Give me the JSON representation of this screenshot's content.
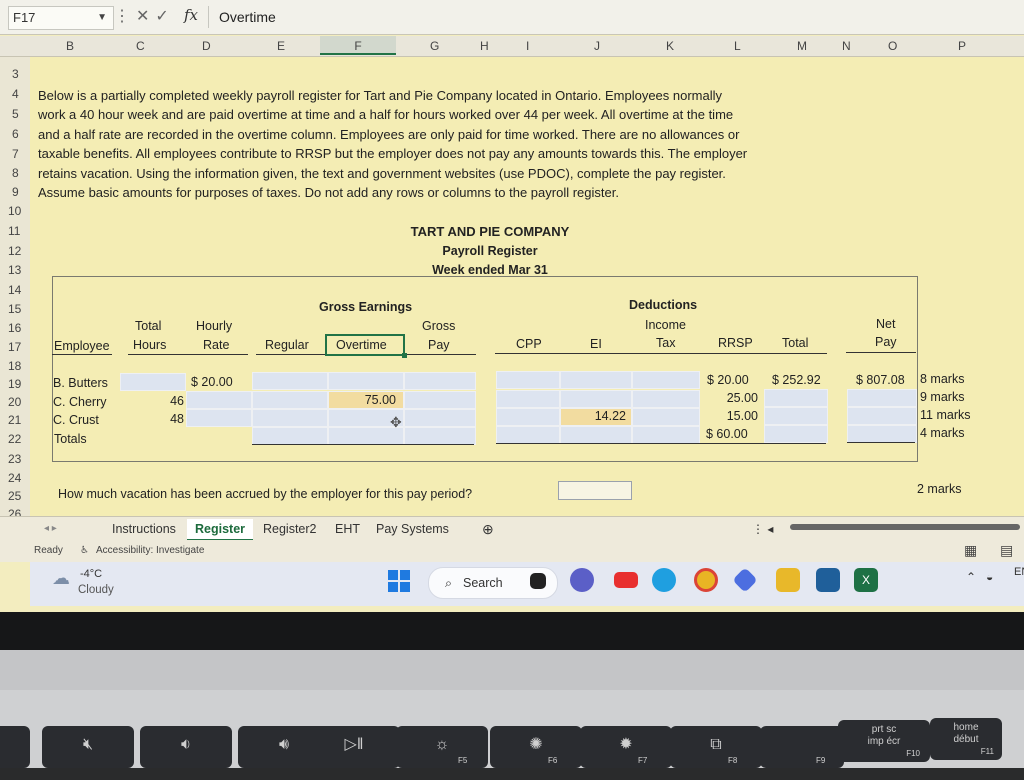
{
  "formula_bar": {
    "name_box": "F17",
    "formula": "Overtime"
  },
  "columns": [
    "B",
    "C",
    "D",
    "E",
    "F",
    "G",
    "H",
    "I",
    "J",
    "K",
    "L",
    "M",
    "N",
    "O",
    "P"
  ],
  "rows": [
    "3",
    "4",
    "5",
    "6",
    "7",
    "8",
    "9",
    "10",
    "11",
    "12",
    "13",
    "14",
    "15",
    "16",
    "17",
    "18",
    "19",
    "20",
    "21",
    "22",
    "23",
    "24",
    "25",
    "26"
  ],
  "description_lines": [
    "Below is a partially completed weekly payroll register for Tart and Pie Company located in Ontario.  Employees normally",
    "work a 40 hour week and are paid overtime at time and a half for hours worked over 44 per week.  All overtime at the time",
    "and a half rate are recorded in the overtime column.  Employees are only paid for time worked.  There are no allowances or",
    "taxable benefits.  All employees contribute to RRSP but the employer does not pay any amounts towards this.  The employer",
    "retains vacation.  Using the information given, the text and government websites (use PDOC), complete the pay register.",
    "Assume basic amounts for purposes of taxes.  Do not add any rows or columns to the payroll register."
  ],
  "company": {
    "name": "TART AND PIE COMPANY",
    "title": "Payroll Register",
    "period": "Week ended Mar 31"
  },
  "register": {
    "group_gross": "Gross Earnings",
    "group_deductions": "Deductions",
    "headers": {
      "employee": "Employee",
      "total_hours_1": "Total",
      "total_hours_2": "Hours",
      "hourly_rate_1": "Hourly",
      "hourly_rate_2": "Rate",
      "regular": "Regular",
      "overtime": "Overtime",
      "gross_pay_1": "Gross",
      "gross_pay_2": "Pay",
      "cpp": "CPP",
      "ei": "EI",
      "income_tax_1": "Income",
      "income_tax_2": "Tax",
      "rrsp": "RRSP",
      "total": "Total",
      "net_pay_1": "Net",
      "net_pay_2": "Pay"
    },
    "rows": [
      {
        "employee": "B. Butters",
        "hours": "",
        "rate": "$ 20.00",
        "overtime": "",
        "ei": "",
        "rrsp": "$ 20.00",
        "total": "$ 252.92",
        "net": "$    807.08",
        "marks": "8 marks"
      },
      {
        "employee": "C. Cherry",
        "hours": "46",
        "rate": "",
        "overtime": "75.00",
        "ei": "",
        "rrsp": "25.00",
        "total": "",
        "net": "",
        "marks": "9 marks"
      },
      {
        "employee": "C. Crust",
        "hours": "48",
        "rate": "",
        "overtime": "",
        "ei": "14.22",
        "rrsp": "15.00",
        "total": "",
        "net": "",
        "marks": "11 marks"
      },
      {
        "employee": "Totals",
        "hours": "",
        "rate": "",
        "overtime": "",
        "ei": "",
        "rrsp": "$ 60.00",
        "total": "",
        "net": "",
        "marks": "4 marks"
      }
    ]
  },
  "question": {
    "text": "How much vacation has been accrued by the employer for this pay period?",
    "marks": "2 marks"
  },
  "sheet_tabs": [
    "Instructions",
    "Register",
    "Register2",
    "EHT",
    "Pay Systems"
  ],
  "active_tab": "Register",
  "status": {
    "ready": "Ready",
    "accessibility": "Accessibility: Investigate"
  },
  "taskbar": {
    "weather_temp": "-4°C",
    "weather_desc": "Cloudy",
    "search": "Search",
    "lang": "EN"
  },
  "keyboard": {
    "f10_line1": "prt sc",
    "f10_line2": "imp écr",
    "f10": "F10",
    "f11_line1": "home",
    "f11_line2": "début",
    "f11": "F11",
    "labels": [
      "F5",
      "F6",
      "F7",
      "F8",
      "F9"
    ]
  },
  "colors": {
    "sheet_bg": "#f4edb4",
    "input_cell": "#dde4f0",
    "highlight_cell": "#f2dca0",
    "excel_green": "#217346"
  }
}
